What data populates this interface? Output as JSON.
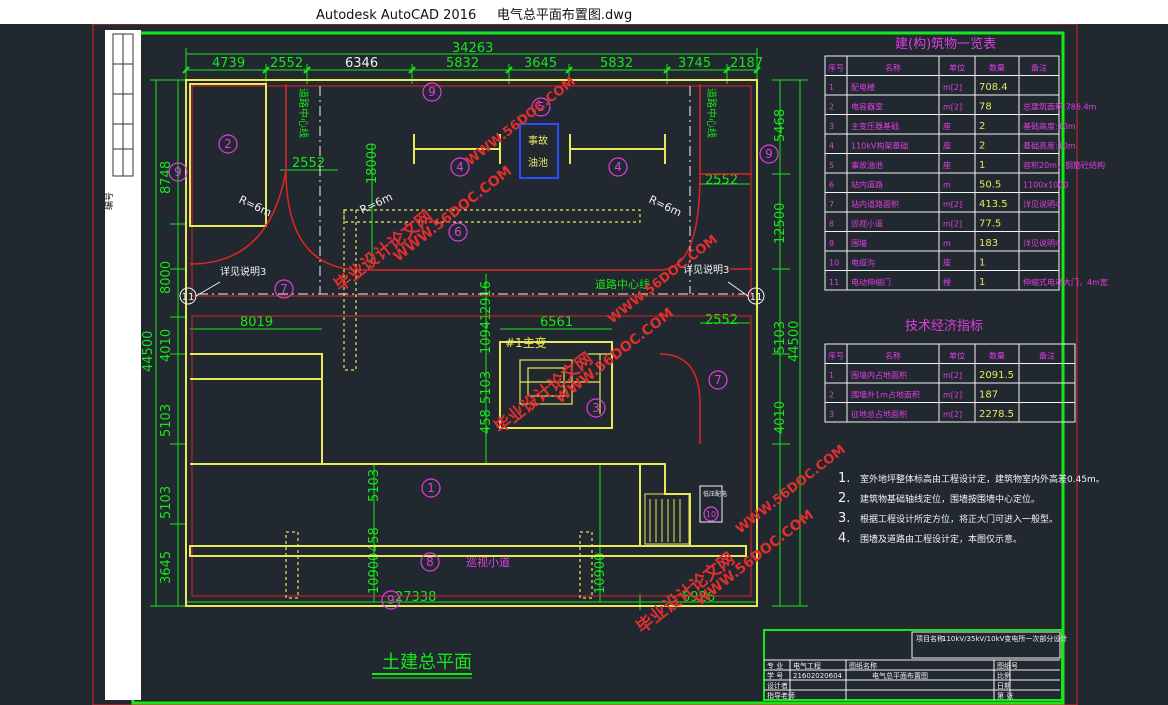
{
  "window": {
    "app_title": "Autodesk AutoCAD 2016",
    "file_name": "电气总平面布置图.dwg"
  },
  "side_label": "编号",
  "dimensions": {
    "top_total": "34263",
    "top_row": [
      "4739",
      "2552",
      "6346",
      "5832",
      "3645",
      "5832",
      "3745",
      "2187"
    ],
    "left_top": "8748",
    "left_mid": "8000",
    "left_total": "44500",
    "left_lower": [
      "4010",
      "5103",
      "5103",
      "3645"
    ],
    "right_top": "5468",
    "right_mid": "12500",
    "right_total": "44500",
    "right_lower": [
      "5103",
      "4010"
    ],
    "inner_18000": "18000",
    "inner_2552a": "2552",
    "inner_2552b": "2552",
    "inner_2552c": "2552",
    "inner_8019": "8019",
    "inner_6561": "6561",
    "inner_2916": "2916",
    "inner_10941": "10941",
    "inner_5103a": "5103",
    "inner_5103b": "5103",
    "inner_458": "458",
    "inner_458b": "458",
    "bottom_left": "27338",
    "bottom_right": "6926",
    "bot_vert_a": "10900",
    "bot_vert_b": "10900",
    "r6m_a": "R=6m",
    "r6m_b": "R=6m",
    "r6m_c": "R=6m"
  },
  "labels": {
    "road_center_v1": "道路中心线",
    "road_center_v2": "道路中心线",
    "road_center_h": "道路中心线",
    "fire_pool_1": "事故",
    "fire_pool_2": "油池",
    "main_transformer": "#1主变",
    "patrol_road": "巡视小道",
    "gate_note_left": "详见说明3",
    "gate_note_right": "详见说明3",
    "drawing_title": "土建总平面",
    "small_box": "低压配电",
    "circles": [
      "1",
      "2",
      "3",
      "4",
      "4",
      "5",
      "6",
      "7",
      "7",
      "8",
      "9",
      "9",
      "9",
      "10",
      "11",
      "11"
    ]
  },
  "building_table": {
    "title": "建(构)筑物一览表",
    "headers": [
      "序号",
      "名称",
      "单位",
      "数量",
      "备注"
    ],
    "rows": [
      [
        "1",
        "配电楼",
        "m[2]",
        "708.4",
        ""
      ],
      [
        "2",
        "电容器室",
        "m[2]",
        "78",
        "总建筑面积:786.4m"
      ],
      [
        "3",
        "主变压器基础",
        "座",
        "2",
        "基础高度:10m"
      ],
      [
        "4",
        "110kV构架基础",
        "座",
        "2",
        "基础高度:10m"
      ],
      [
        "5",
        "事故油池",
        "座",
        "1",
        "容积20m，钢筋砼结构"
      ],
      [
        "6",
        "站内道路",
        "m",
        "50.5",
        "1100x1000"
      ],
      [
        "7",
        "站内道路面积",
        "m[2]",
        "413.5",
        "详见说明4"
      ],
      [
        "8",
        "巡视小道",
        "m[2]",
        "77.5",
        ""
      ],
      [
        "9",
        "围墙",
        "m",
        "183",
        "详见说明4"
      ],
      [
        "10",
        "电缆沟",
        "座",
        "1",
        ""
      ],
      [
        "11",
        "电动伸缩门",
        "樘",
        "1",
        "伸缩式电动大门，4m宽"
      ]
    ]
  },
  "econ_table": {
    "title": "技术经济指标",
    "headers": [
      "序号",
      "名称",
      "单位",
      "数量",
      "备注"
    ],
    "rows": [
      [
        "1",
        "围墙内占地面积",
        "m[2]",
        "2091.5",
        ""
      ],
      [
        "2",
        "围墙外1m占地面积",
        "m[2]",
        "187",
        ""
      ],
      [
        "3",
        "征地总占地面积",
        "m[2]",
        "2278.5",
        ""
      ]
    ]
  },
  "notes": [
    {
      "num": "1.",
      "text": "室外地坪整体标高由工程设计定，建筑物室内外高差0.45m。"
    },
    {
      "num": "2.",
      "text": "建筑物基础轴线定位，围墙按围墙中心定位。"
    },
    {
      "num": "3.",
      "text": "根据工程设计所定方位，将正大门可进入一般型。"
    },
    {
      "num": "4.",
      "text": "围墙及道路由工程设计定，本图仅示意。"
    }
  ],
  "title_block": {
    "project_label": "项目名称",
    "project": "110kV/35kV/10kV变电所一次部分设计",
    "rows": [
      [
        "专 业",
        "电气工程",
        "图纸名称",
        "电气总平面布置图"
      ],
      [
        "学 号",
        "21602020604",
        "",
        ""
      ],
      [
        "设计者",
        "",
        ""
      ],
      [
        "指导老师",
        "",
        ""
      ]
    ],
    "right_cells": [
      "图纸号",
      "比例",
      "日期",
      "第 张"
    ]
  },
  "watermarks": [
    "WWW.56DOC.COM",
    "毕业设计论文网"
  ],
  "colors": {
    "background": "#212830",
    "frame": "#19e619",
    "yellow": "#e8e85a",
    "cyan": "#3ee0e0",
    "magenta": "#e13ee1",
    "red": "#e02424",
    "white": "#f2f2f2",
    "watermark": "#e02f2f"
  }
}
